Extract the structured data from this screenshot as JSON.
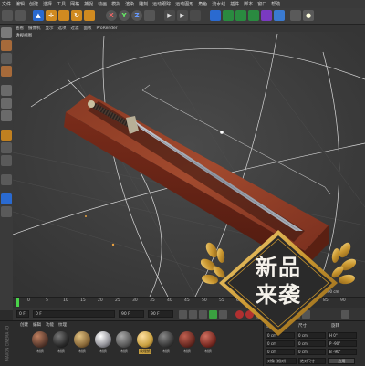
{
  "menu": {
    "items": [
      "文件",
      "编辑",
      "创建",
      "选择",
      "工具",
      "网格",
      "捕捉",
      "动画",
      "模拟",
      "渲染",
      "雕刻",
      "运动跟踪",
      "运动图形",
      "角色",
      "流水线",
      "插件",
      "脚本",
      "窗口",
      "帮助"
    ]
  },
  "toolbar": {
    "axis_labels": [
      "X",
      "Y",
      "Z"
    ]
  },
  "viewport": {
    "menu": [
      "查看",
      "摄像机",
      "显示",
      "选项",
      "过滤",
      "面板",
      "ProRender"
    ],
    "label": "透视视图",
    "grid_spacing": "网格间距 : 1000 cm"
  },
  "timeline": {
    "ticks": [
      "0",
      "5",
      "10",
      "15",
      "20",
      "25",
      "30",
      "35",
      "40",
      "45",
      "50",
      "55",
      "60",
      "65",
      "70",
      "75",
      "80",
      "85",
      "90"
    ]
  },
  "transport": {
    "start": "0 F",
    "current": "0 F",
    "end": "90 F",
    "end2": "90 F"
  },
  "materials": {
    "menu": [
      "创建",
      "编辑",
      "功能",
      "纹理"
    ],
    "items": [
      {
        "label": "材质",
        "color": "#5a3a2e"
      },
      {
        "label": "材质",
        "color": "#2a2a2a"
      },
      {
        "label": "材质",
        "color": "#8a6a3a"
      },
      {
        "label": "材质",
        "color": "#9a9aa0"
      },
      {
        "label": "材质",
        "color": "#5a5a5a"
      },
      {
        "label": "纹理纸",
        "color": "#c8a040"
      },
      {
        "label": "材质",
        "color": "#3a3a3a"
      },
      {
        "label": "材质",
        "color": "#6a2a22"
      },
      {
        "label": "材质",
        "color": "#7a2a22"
      }
    ]
  },
  "coords": {
    "header": [
      "位置",
      "尺寸",
      "旋转"
    ],
    "rows": [
      [
        "0 cm",
        "0 cm",
        "H 0°"
      ],
      [
        "0 cm",
        "0 cm",
        "P -90°"
      ],
      [
        "0 cm",
        "0 cm",
        "B -90°"
      ]
    ],
    "mode": "对象 (相对)",
    "size_mode": "绝对尺寸",
    "apply": "应用"
  },
  "brand": {
    "side": "MAXON CINEMA 4D"
  },
  "badge": {
    "line1": "新品",
    "line2": "来袭"
  },
  "colors": {
    "accent_green": "#4ad34a",
    "badge_dark": "#2a2a2a",
    "gold": "#c9962f"
  }
}
